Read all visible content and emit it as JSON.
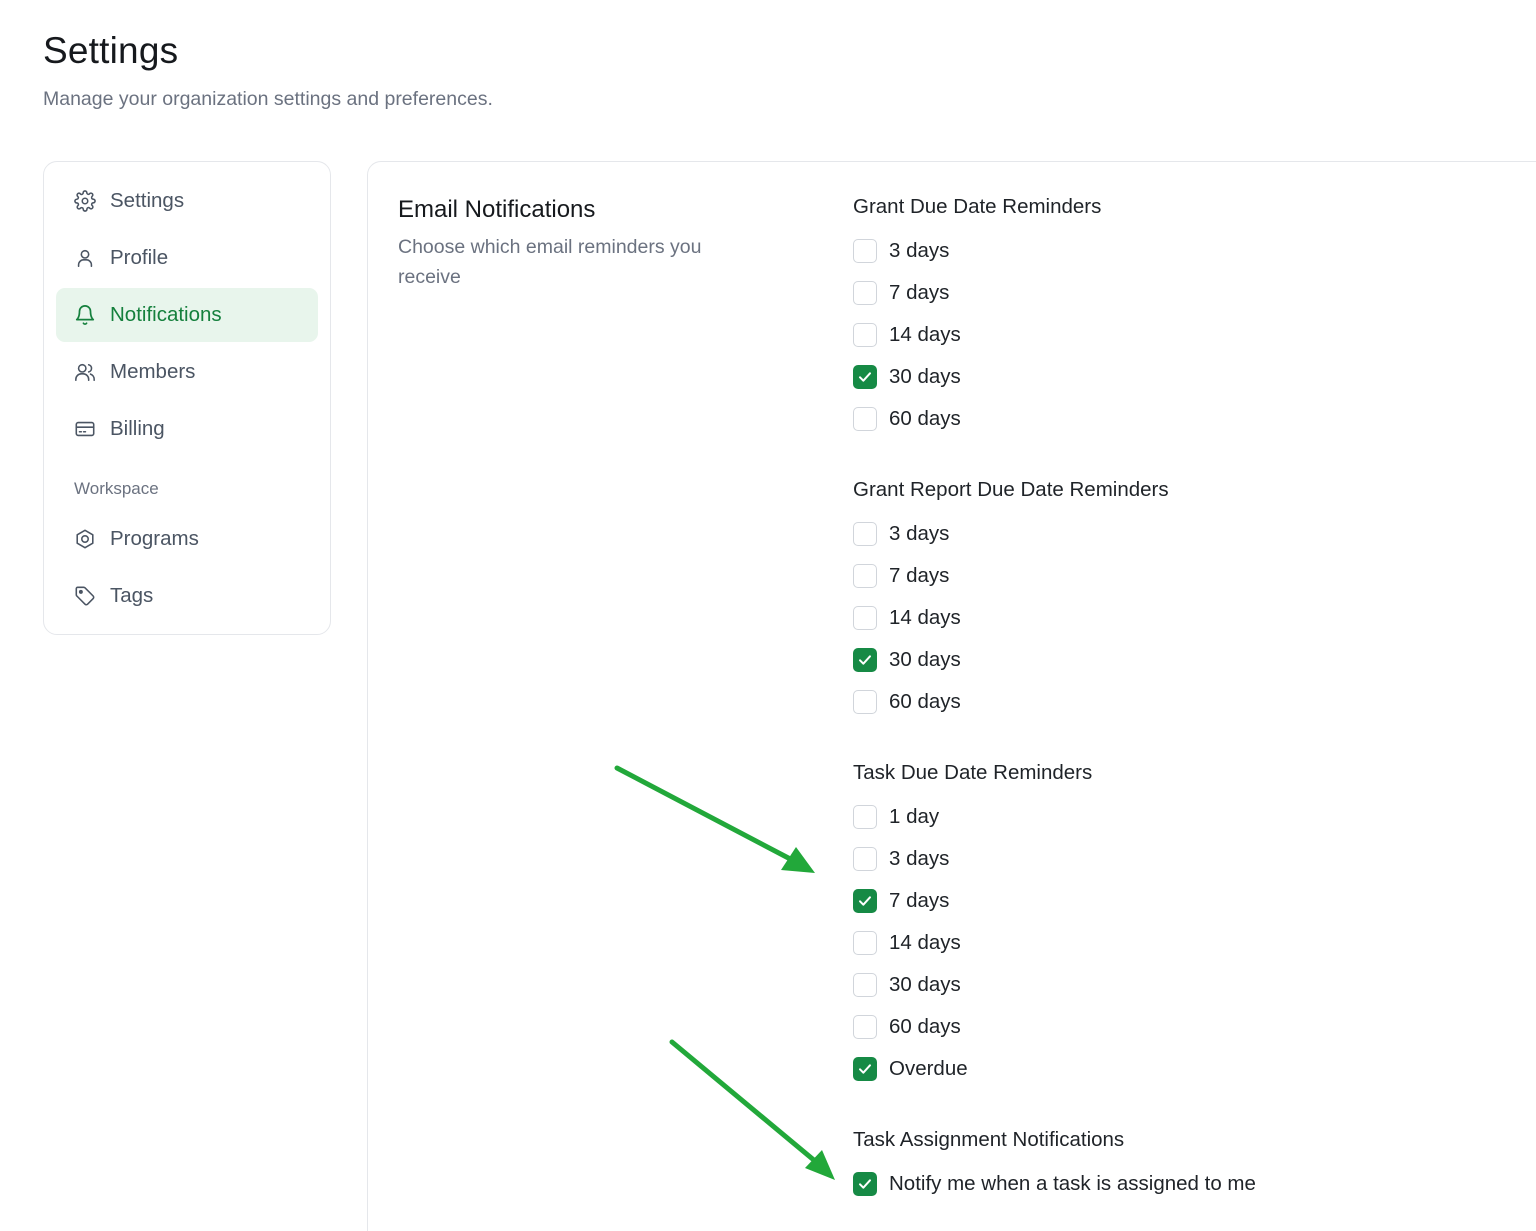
{
  "header": {
    "title": "Settings",
    "subtitle": "Manage your organization settings and preferences."
  },
  "sidebar": {
    "items": [
      {
        "label": "Settings",
        "icon": "gear-icon",
        "active": false
      },
      {
        "label": "Profile",
        "icon": "user-icon",
        "active": false
      },
      {
        "label": "Notifications",
        "icon": "bell-icon",
        "active": true
      },
      {
        "label": "Members",
        "icon": "users-icon",
        "active": false
      },
      {
        "label": "Billing",
        "icon": "credit-card-icon",
        "active": false
      }
    ],
    "workspace_label": "Workspace",
    "workspace_items": [
      {
        "label": "Programs",
        "icon": "hexagon-icon",
        "active": false
      },
      {
        "label": "Tags",
        "icon": "tag-icon",
        "active": false
      }
    ]
  },
  "email_notifications": {
    "title": "Email Notifications",
    "description": "Choose which email reminders you receive",
    "groups": [
      {
        "title": "Grant Due Date Reminders",
        "options": [
          {
            "label": "3 days",
            "checked": false
          },
          {
            "label": "7 days",
            "checked": false
          },
          {
            "label": "14 days",
            "checked": false
          },
          {
            "label": "30 days",
            "checked": true
          },
          {
            "label": "60 days",
            "checked": false
          }
        ]
      },
      {
        "title": "Grant Report Due Date Reminders",
        "options": [
          {
            "label": "3 days",
            "checked": false
          },
          {
            "label": "7 days",
            "checked": false
          },
          {
            "label": "14 days",
            "checked": false
          },
          {
            "label": "30 days",
            "checked": true
          },
          {
            "label": "60 days",
            "checked": false
          }
        ]
      },
      {
        "title": "Task Due Date Reminders",
        "options": [
          {
            "label": "1 day",
            "checked": false
          },
          {
            "label": "3 days",
            "checked": false
          },
          {
            "label": "7 days",
            "checked": true
          },
          {
            "label": "14 days",
            "checked": false
          },
          {
            "label": "30 days",
            "checked": false
          },
          {
            "label": "60 days",
            "checked": false
          },
          {
            "label": "Overdue",
            "checked": true
          }
        ]
      },
      {
        "title": "Task Assignment Notifications",
        "options": [
          {
            "label": "Notify me when a task is assigned to me",
            "checked": true
          }
        ]
      }
    ]
  },
  "colors": {
    "accent": "#168a45",
    "active_nav_bg": "#e8f5ec",
    "active_nav_text": "#15803d",
    "annotation_arrow": "#22a83a"
  }
}
